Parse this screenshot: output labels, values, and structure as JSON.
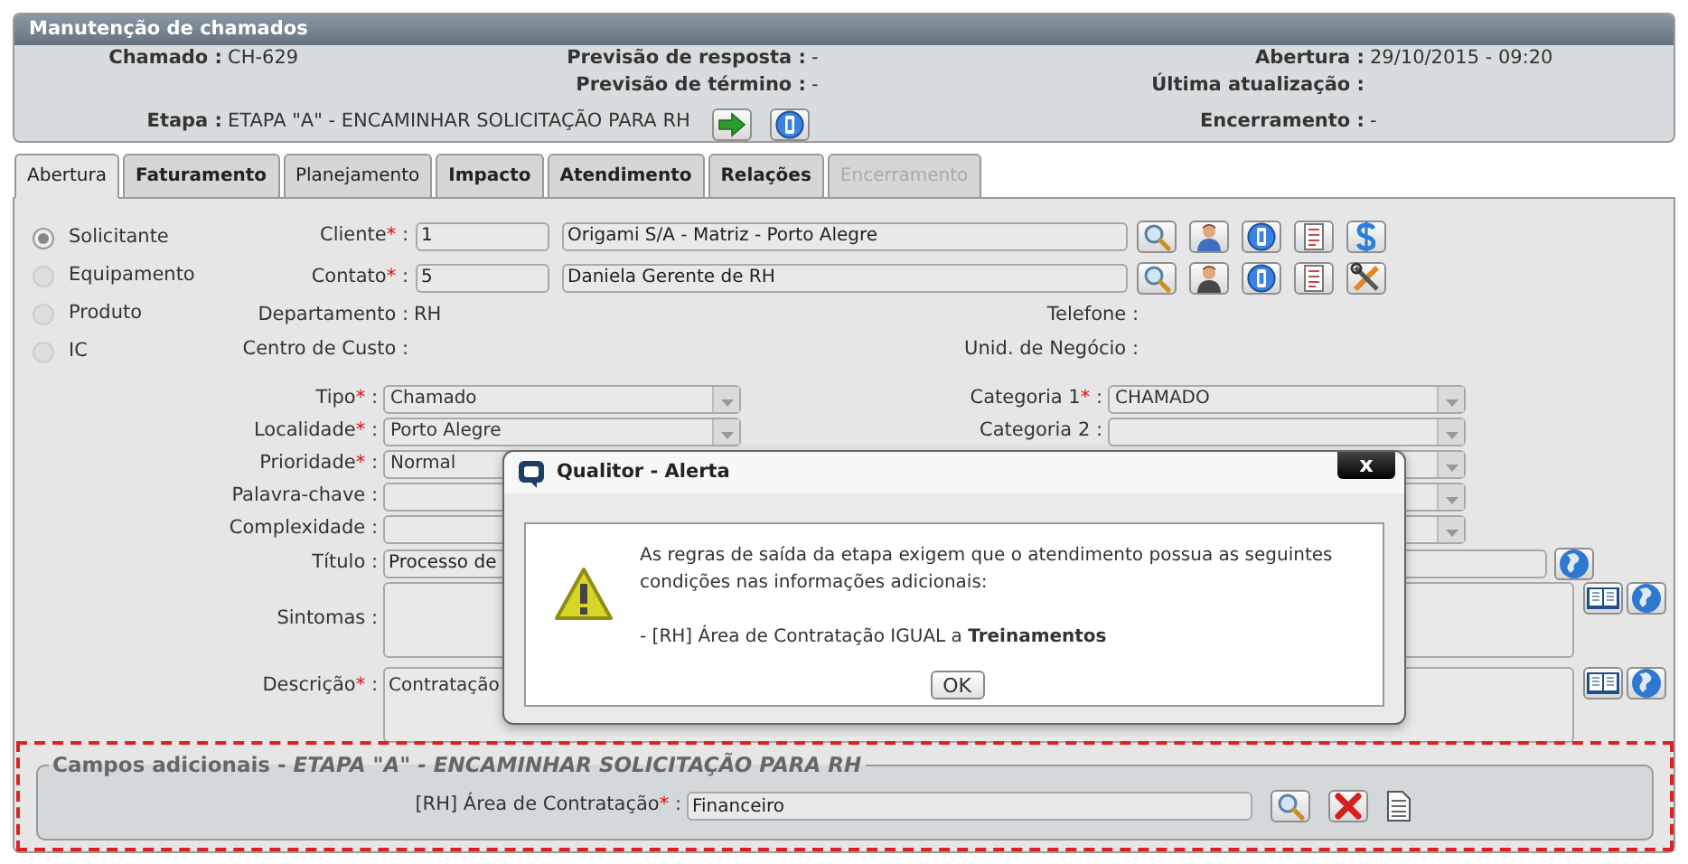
{
  "header": {
    "title": "Manutenção de chamados",
    "rows": [
      [
        {
          "label": "Chamado :",
          "value": "CH-629"
        },
        {
          "label": "Previsão de resposta :",
          "value": "-"
        },
        {
          "label": "Abertura :",
          "value": "29/10/2015 - 09:20"
        }
      ],
      [
        null,
        {
          "label": "Previsão de término :",
          "value": "-"
        },
        {
          "label": "Última atualização :"
        }
      ],
      [
        {
          "label": "Etapa :",
          "value": "ETAPA \"A\" - ENCAMINHAR SOLICITAÇÃO PARA RH",
          "buttons": [
            {
              "kind": "arrow"
            },
            {
              "kind": "info"
            }
          ]
        },
        null,
        {
          "label": "Encerramento :",
          "value": "-"
        }
      ]
    ]
  },
  "tabs": [
    {
      "label": "Abertura",
      "selected": true,
      "disabled": false,
      "bold": false
    },
    {
      "label": "Faturamento",
      "selected": false,
      "disabled": false,
      "bold": true
    },
    {
      "label": "Planejamento",
      "selected": false,
      "disabled": false,
      "bold": false
    },
    {
      "label": "Impacto",
      "selected": false,
      "disabled": false,
      "bold": true
    },
    {
      "label": "Atendimento",
      "selected": false,
      "disabled": false,
      "bold": true
    },
    {
      "label": "Relações",
      "selected": false,
      "disabled": false,
      "bold": true
    },
    {
      "label": "Encerramento",
      "selected": false,
      "disabled": true,
      "bold": false
    }
  ],
  "radios": [
    {
      "label": "Solicitante",
      "selected": true
    },
    {
      "label": "Equipamento",
      "selected": false
    },
    {
      "label": "Produto",
      "selected": false
    },
    {
      "label": "IC",
      "selected": false
    }
  ],
  "lookups": [
    {
      "label": "Cliente",
      "req": "*",
      "colon": ":",
      "code": "1",
      "name": "Origami S/A - Matriz - Porto Alegre",
      "buttons": [
        {
          "kind": "search"
        },
        {
          "kind": "person"
        },
        {
          "kind": "info"
        },
        {
          "kind": "document"
        },
        {
          "kind": "dollar"
        }
      ]
    },
    {
      "label": "Contato",
      "req": "*",
      "colon": ":",
      "code": "5",
      "name": "Daniela Gerente de RH",
      "buttons": [
        {
          "kind": "search"
        },
        {
          "kind": "person-dark"
        },
        {
          "kind": "info"
        },
        {
          "kind": "document"
        },
        {
          "kind": "tools"
        }
      ]
    }
  ],
  "info_rows": [
    [
      {
        "label": "Departamento :",
        "value": "RH"
      },
      {
        "label": "Telefone :"
      }
    ],
    [
      {
        "label": "Centro de Custo :"
      },
      {
        "label": "Unid. de Negócio :"
      }
    ]
  ],
  "selects": [
    [
      {
        "label": "Tipo",
        "req": "*",
        "colon": ":",
        "value": "Chamado"
      },
      {
        "label": "Categoria 1",
        "req": "*",
        "colon": ":",
        "value": "CHAMADO"
      }
    ],
    [
      {
        "label": "Localidade",
        "req": "*",
        "colon": ":",
        "value": "Porto Alegre"
      },
      {
        "label": "Categoria 2 :"
      }
    ],
    [
      {
        "label": "Prioridade",
        "req": "*",
        "colon": ":",
        "value": "Normal"
      }
    ],
    [
      {
        "label": "Palavra-chave :"
      }
    ],
    [
      {
        "label": "Complexidade :"
      }
    ]
  ],
  "title_field": {
    "label": "Título :",
    "value": "Processo de",
    "buttons": [
      {
        "kind": "globe"
      }
    ]
  },
  "textareas": [
    {
      "label": "Sintomas :",
      "buttons": [
        {
          "kind": "book"
        },
        {
          "kind": "globe"
        }
      ]
    },
    {
      "label": "Descrição",
      "req": "*",
      "colon": ":",
      "value": "Contratação",
      "buttons": [
        {
          "kind": "book"
        },
        {
          "kind": "globe"
        }
      ]
    }
  ],
  "additional": {
    "legend": "Campos adicionais - *ETAPA \"A\" - ENCAMINHAR SOLICITAÇÃO PARA RH*",
    "field": {
      "label": "[RH] Área de Contratação",
      "req": "*",
      "colon": ":",
      "value": "Financeiro",
      "buttons": [
        {
          "kind": "search"
        },
        {
          "kind": "delete"
        },
        {
          "kind": "page"
        }
      ]
    }
  },
  "dialog": {
    "title": "Qualitor - Alerta",
    "close": "x",
    "message": "As regras de saída da etapa exigem que o atendimento possua as seguintes condições nas informações adicionais:",
    "condition": "- [RH] Área de Contratação IGUAL a **Treinamentos**",
    "button": "OK"
  }
}
